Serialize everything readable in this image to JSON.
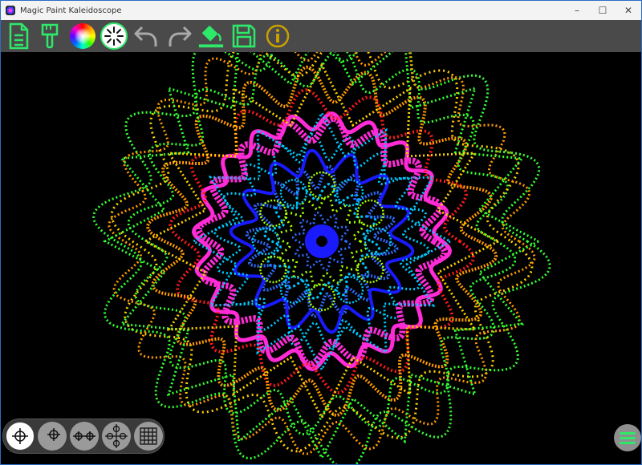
{
  "window": {
    "title": "Magic Paint Kaleidoscope"
  },
  "controls": {
    "minimize": "–",
    "maximize": "☐",
    "close": "✕"
  },
  "toolbar": {
    "tools": [
      {
        "name": "new-document"
      },
      {
        "name": "brush"
      },
      {
        "name": "color-wheel"
      },
      {
        "name": "brush-style",
        "selected": true
      },
      {
        "name": "undo"
      },
      {
        "name": "redo"
      },
      {
        "name": "fill"
      },
      {
        "name": "save"
      },
      {
        "name": "info"
      }
    ],
    "accent": "#2ee86a"
  },
  "symmetry": {
    "modes": [
      {
        "name": "single-center",
        "active": true
      },
      {
        "name": "single-point"
      },
      {
        "name": "two-points"
      },
      {
        "name": "four-points"
      },
      {
        "name": "grid"
      }
    ]
  },
  "kaleidoscope": {
    "colors": [
      "#1a1aff",
      "#2d6bff",
      "#00c8ff",
      "#a6ff00",
      "#ff2bd6",
      "#ff1a1a",
      "#ff9a00",
      "#ffd000",
      "#33ff33"
    ]
  }
}
